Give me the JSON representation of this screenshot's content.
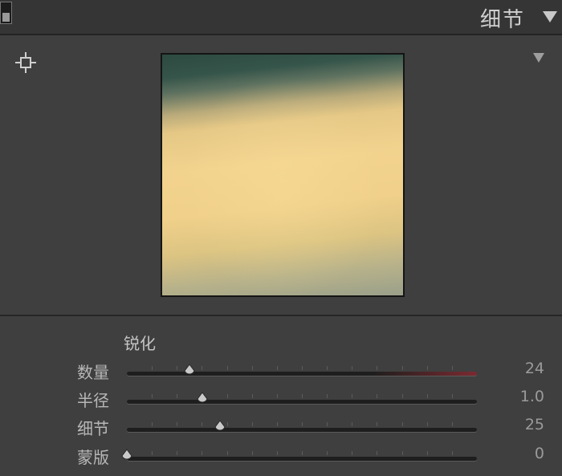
{
  "panel": {
    "title": "细节",
    "collapse_icon": "triangle-down-icon",
    "switch_icon": "panel-switch-icon"
  },
  "preview": {
    "target_icon": "crosshair-target-icon",
    "menu_icon": "triangle-down-icon"
  },
  "sharpening": {
    "label": "锐化",
    "sliders": [
      {
        "label": "数量",
        "value": "24",
        "fraction": 0.18,
        "active": true
      },
      {
        "label": "半径",
        "value": "1.0",
        "fraction": 0.215,
        "active": false
      },
      {
        "label": "细节",
        "value": "25",
        "fraction": 0.265,
        "active": false
      },
      {
        "label": "蒙版",
        "value": "0",
        "fraction": 0.0,
        "active": false
      }
    ]
  },
  "colors": {
    "panel_bg": "#3f3f3f",
    "header_bg": "#353535",
    "accent_fill": "#7a2a30"
  }
}
